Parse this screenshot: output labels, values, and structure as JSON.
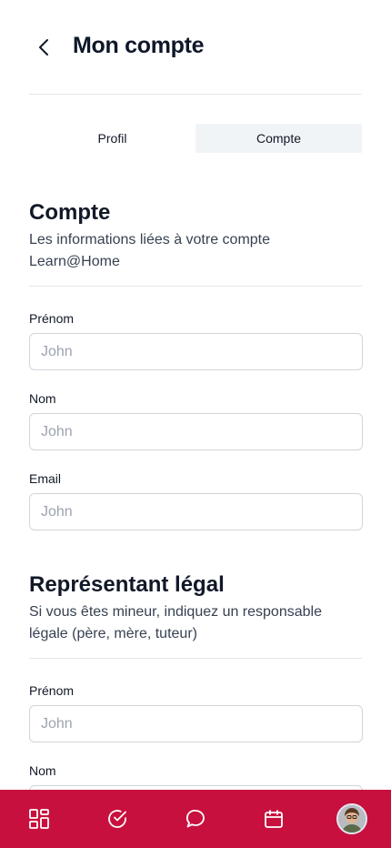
{
  "header": {
    "title": "Mon compte",
    "back_icon": "chevron-left-icon"
  },
  "tabs": [
    {
      "label": "Profil",
      "active": false
    },
    {
      "label": "Compte",
      "active": true
    }
  ],
  "account_section": {
    "title": "Compte",
    "description": "Les informations liées à votre compte Learn@Home",
    "fields": [
      {
        "label": "Prénom",
        "value": "",
        "placeholder": "John"
      },
      {
        "label": "Nom",
        "value": "",
        "placeholder": "John"
      },
      {
        "label": "Email",
        "value": "",
        "placeholder": "John"
      }
    ]
  },
  "guardian_section": {
    "title": "Représentant légal",
    "description": "Si vous êtes mineur, indiquez un responsable légale (père, mère, tuteur)",
    "fields": [
      {
        "label": "Prénom",
        "value": "",
        "placeholder": "John"
      },
      {
        "label": "Nom",
        "value": "",
        "placeholder": "John"
      }
    ]
  },
  "bottom_nav": {
    "background": "#c8103e",
    "items": [
      "dashboard-grid-icon",
      "check-circle-icon",
      "chat-bubble-icon",
      "calendar-icon",
      "avatar"
    ]
  }
}
